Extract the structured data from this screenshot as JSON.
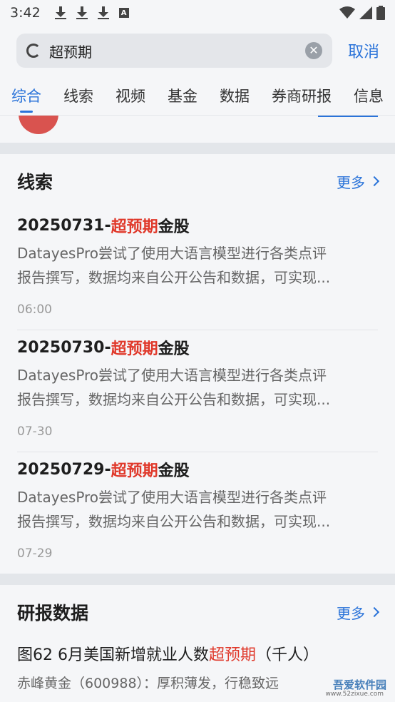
{
  "status": {
    "time": "3:42"
  },
  "search": {
    "query": "超预期",
    "cancel": "取消"
  },
  "tabs": [
    "综合",
    "线索",
    "视频",
    "基金",
    "数据",
    "券商研报",
    "信息"
  ],
  "clues": {
    "title": "线索",
    "more": "更多",
    "items": [
      {
        "prefix": "20250731-",
        "keyword": "超预期",
        "suffix": "金股",
        "desc1": "DatayesPro尝试了使用大语言模型进行各类点评",
        "desc2": "报告撰写，数据均来自公开公告和数据，可实现...",
        "time": "06:00"
      },
      {
        "prefix": "20250730-",
        "keyword": "超预期",
        "suffix": "金股",
        "desc1": "DatayesPro尝试了使用大语言模型进行各类点评",
        "desc2": "报告撰写，数据均来自公开公告和数据，可实现...",
        "time": "07-30"
      },
      {
        "prefix": "20250729-",
        "keyword": "超预期",
        "suffix": "金股",
        "desc1": "DatayesPro尝试了使用大语言模型进行各类点评",
        "desc2": "报告撰写，数据均来自公开公告和数据，可实现...",
        "time": "07-29"
      }
    ]
  },
  "reports": {
    "title": "研报数据",
    "more": "更多",
    "item_prefix": "图62 6月美国新增就业人数",
    "item_keyword": "超预期",
    "item_suffix": "（千人）",
    "item_sub": "赤峰黄金（600988）：厚积薄发，行稳致远"
  },
  "watermark": {
    "name": "吾爱软件园",
    "url": "www.52zixue.com"
  }
}
